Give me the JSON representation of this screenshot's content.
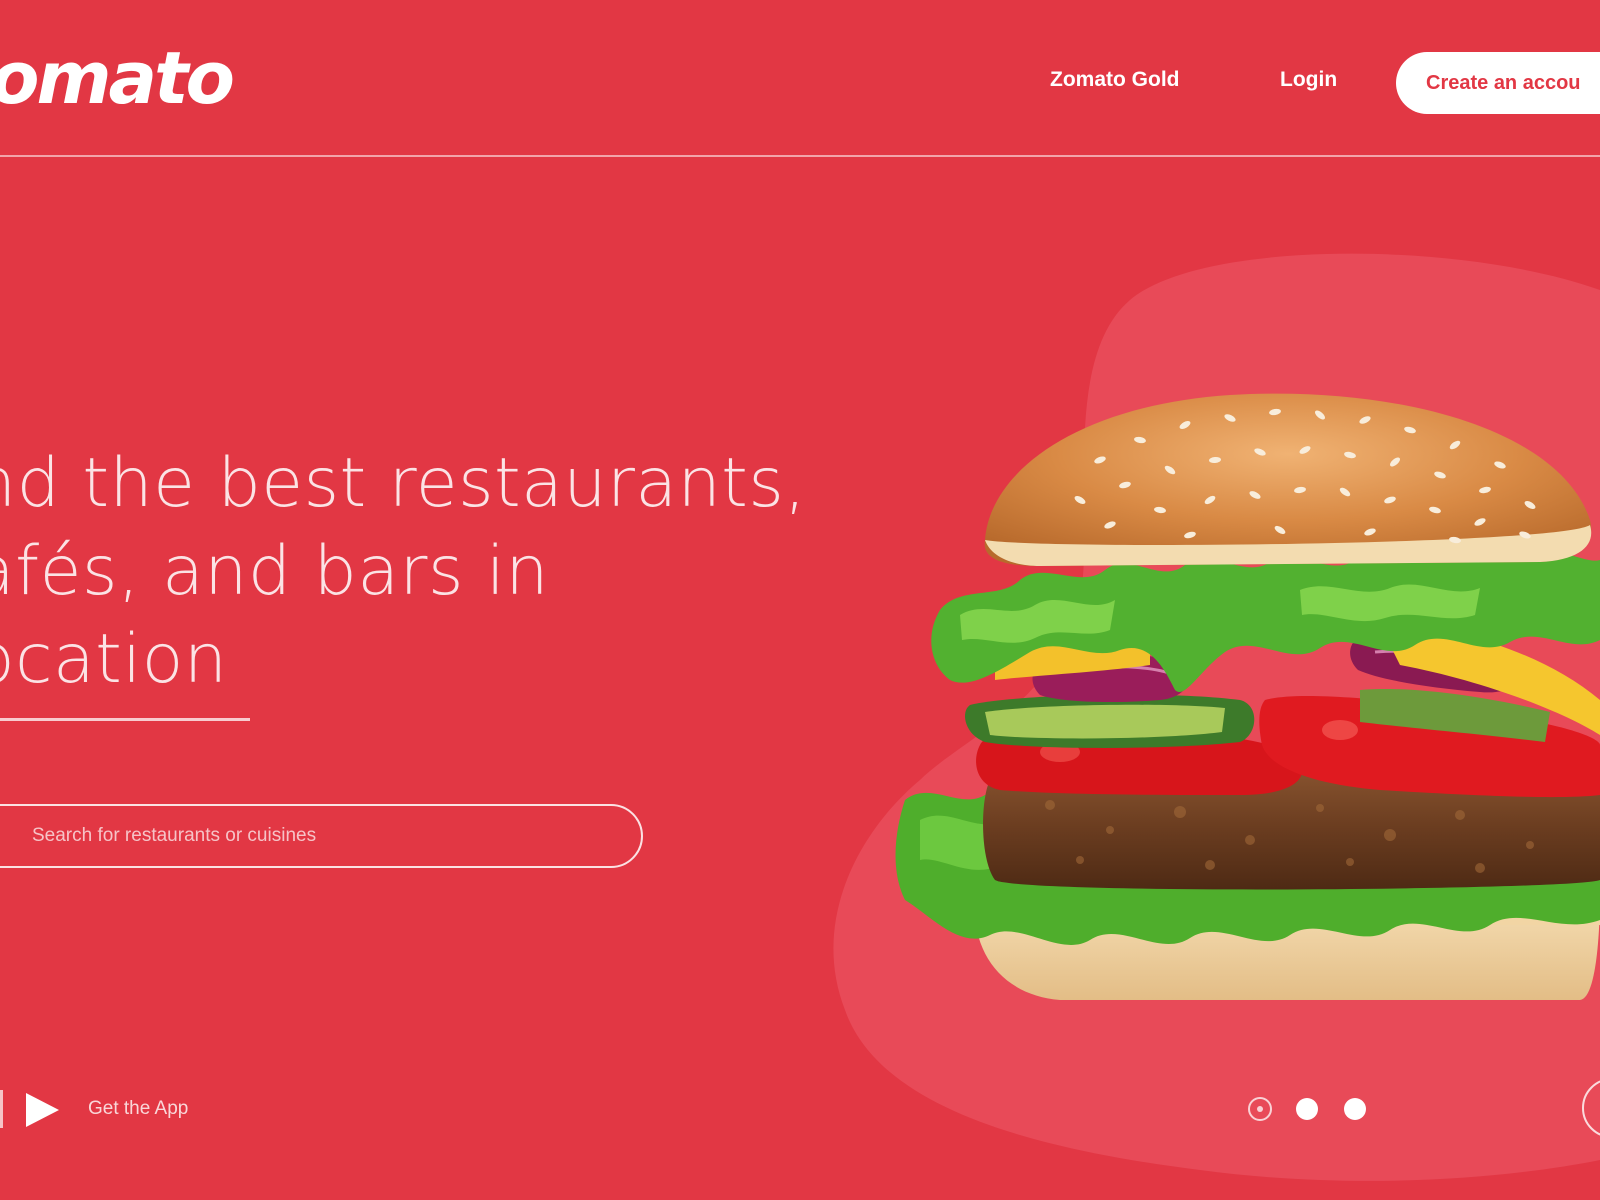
{
  "header": {
    "logo_text": "omato",
    "nav": {
      "gold_label": "Zomato Gold",
      "login_label": "Login",
      "create_account_label": "Create an accou"
    }
  },
  "hero": {
    "headline_line1": "nd the best restaurants,",
    "headline_line2": "afés, and bars in",
    "headline_line3": "ocation"
  },
  "search": {
    "placeholder": "Search for restaurants or cuisines"
  },
  "footer": {
    "get_app_label": "Get the App"
  },
  "carousel": {
    "dot_count": 3,
    "active_index": 0
  },
  "colors": {
    "brand_red": "#e23744",
    "blob": "#e84a58",
    "text_light": "#fbe3e5"
  },
  "icons": {
    "play": "play-icon",
    "next": "chevron-right-icon"
  },
  "image": {
    "hero_food": "burger"
  }
}
